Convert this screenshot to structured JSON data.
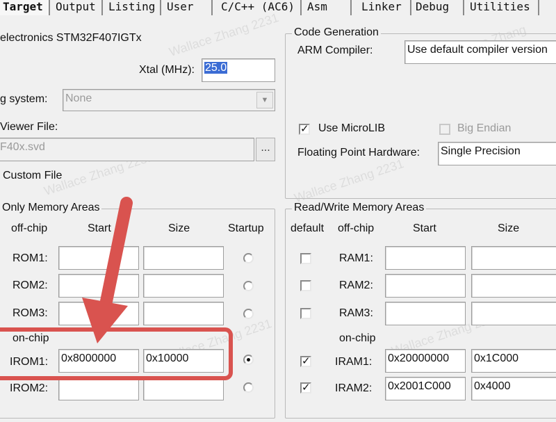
{
  "tabs": [
    "Target",
    "Output",
    "Listing",
    "User",
    "C/C++ (AC6)",
    "Asm",
    "Linker",
    "Debug",
    "Utilities"
  ],
  "device": "electronics STM32F407IGTx",
  "xtal": {
    "label": "Xtal (MHz):",
    "value": "25.0"
  },
  "os": {
    "label": "g system:",
    "value": "None"
  },
  "viewer": {
    "label": "Viewer File:",
    "value": "F40x.svd",
    "browse": "..."
  },
  "custom_file": "Custom File",
  "code_gen": {
    "title": "Code Generation",
    "compiler_label": "ARM Compiler:",
    "compiler_value": "Use default compiler version",
    "microlib": "Use MicroLIB",
    "big_endian": "Big Endian",
    "fph_label": "Floating Point Hardware:",
    "fph_value": "Single Precision"
  },
  "rom": {
    "title": "Only Memory Areas",
    "headers": {
      "offchip": "off-chip",
      "start": "Start",
      "size": "Size",
      "startup": "Startup"
    },
    "rows": [
      {
        "label": "ROM1:",
        "start": "",
        "size": ""
      },
      {
        "label": "ROM2:",
        "start": "",
        "size": ""
      },
      {
        "label": "ROM3:",
        "start": "",
        "size": ""
      }
    ],
    "onchip": "on-chip",
    "irom": [
      {
        "label": "IROM1:",
        "start": "0x8000000",
        "size": "0x10000",
        "startup": true
      },
      {
        "label": "IROM2:",
        "start": "",
        "size": "",
        "startup": false
      }
    ]
  },
  "ram": {
    "title": "Read/Write Memory Areas",
    "headers": {
      "default": "default",
      "offchip": "off-chip",
      "start": "Start",
      "size": "Size"
    },
    "rows": [
      {
        "label": "RAM1:",
        "start": "",
        "size": ""
      },
      {
        "label": "RAM2:",
        "start": "",
        "size": ""
      },
      {
        "label": "RAM3:",
        "start": "",
        "size": ""
      }
    ],
    "onchip": "on-chip",
    "iram": [
      {
        "label": "IRAM1:",
        "start": "0x20000000",
        "size": "0x1C000",
        "checked": true
      },
      {
        "label": "IRAM2:",
        "start": "0x2001C000",
        "size": "0x4000",
        "checked": true
      }
    ]
  },
  "annotation": {
    "color": "#d9534f"
  }
}
